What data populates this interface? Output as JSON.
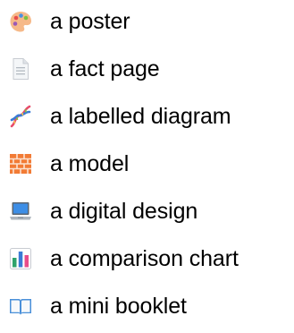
{
  "items": [
    {
      "icon": "palette-icon",
      "label": "a poster"
    },
    {
      "icon": "page-facing-up-icon",
      "label": "a fact page"
    },
    {
      "icon": "dna-icon",
      "label": "a labelled diagram"
    },
    {
      "icon": "bricks-icon",
      "label": "a model"
    },
    {
      "icon": "laptop-icon",
      "label": "a digital design"
    },
    {
      "icon": "bar-chart-icon",
      "label": "a comparison chart"
    },
    {
      "icon": "open-book-icon",
      "label": "a mini booklet"
    }
  ]
}
